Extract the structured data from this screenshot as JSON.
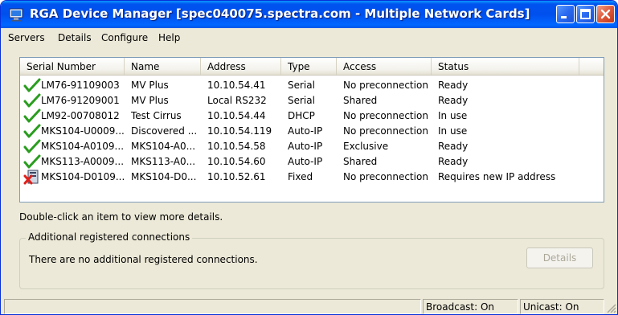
{
  "window": {
    "title": "RGA Device Manager [spec040075.spectra.com - Multiple Network Cards]"
  },
  "menu": [
    "Servers",
    "Details",
    "Configure",
    "Help"
  ],
  "table": {
    "columns": [
      "Serial Number",
      "Name",
      "Address",
      "Type",
      "Access",
      "Status"
    ],
    "rows": [
      {
        "icon": "check-icon",
        "serial": "LM76-91109003",
        "name": "MV Plus",
        "address": "10.10.54.41",
        "type": "Serial",
        "access": "No preconnection",
        "status": "Ready"
      },
      {
        "icon": "check-icon",
        "serial": "LM76-91209001",
        "name": "MV Plus",
        "address": "Local RS232",
        "type": "Serial",
        "access": "Shared",
        "status": "Ready"
      },
      {
        "icon": "check-icon",
        "serial": "LM92-00708012",
        "name": "Test Cirrus",
        "address": "10.10.54.44",
        "type": "DHCP",
        "access": "No preconnection",
        "status": "In use"
      },
      {
        "icon": "check-icon",
        "serial": "MKS104-U0009...",
        "name": "Discovered ...",
        "address": "10.10.54.119",
        "type": "Auto-IP",
        "access": "No preconnection",
        "status": "In use"
      },
      {
        "icon": "check-icon",
        "serial": "MKS104-A0109...",
        "name": "MKS104-A0...",
        "address": "10.10.54.58",
        "type": "Auto-IP",
        "access": "Exclusive",
        "status": "Ready"
      },
      {
        "icon": "check-icon",
        "serial": "MKS113-A0009...",
        "name": "MKS113-A0...",
        "address": "10.10.54.60",
        "type": "Auto-IP",
        "access": "Shared",
        "status": "Ready"
      },
      {
        "icon": "error-device-icon",
        "serial": "MKS104-D0109...",
        "name": "MKS104-D0...",
        "address": "10.10.52.61",
        "type": "Fixed",
        "access": "No preconnection",
        "status": "Requires new IP address"
      }
    ]
  },
  "hint": "Double-click an item to view more details.",
  "group": {
    "title": "Additional registered connections",
    "message": "There are no additional registered connections.",
    "details_button": "Details"
  },
  "statusbar": {
    "broadcast": "Broadcast: On",
    "unicast": "Unicast: On"
  },
  "colors": {
    "titlebar": "#0054e3",
    "window_bg": "#ece9d8",
    "check": "#2a9d1f",
    "error": "#e0201b"
  }
}
